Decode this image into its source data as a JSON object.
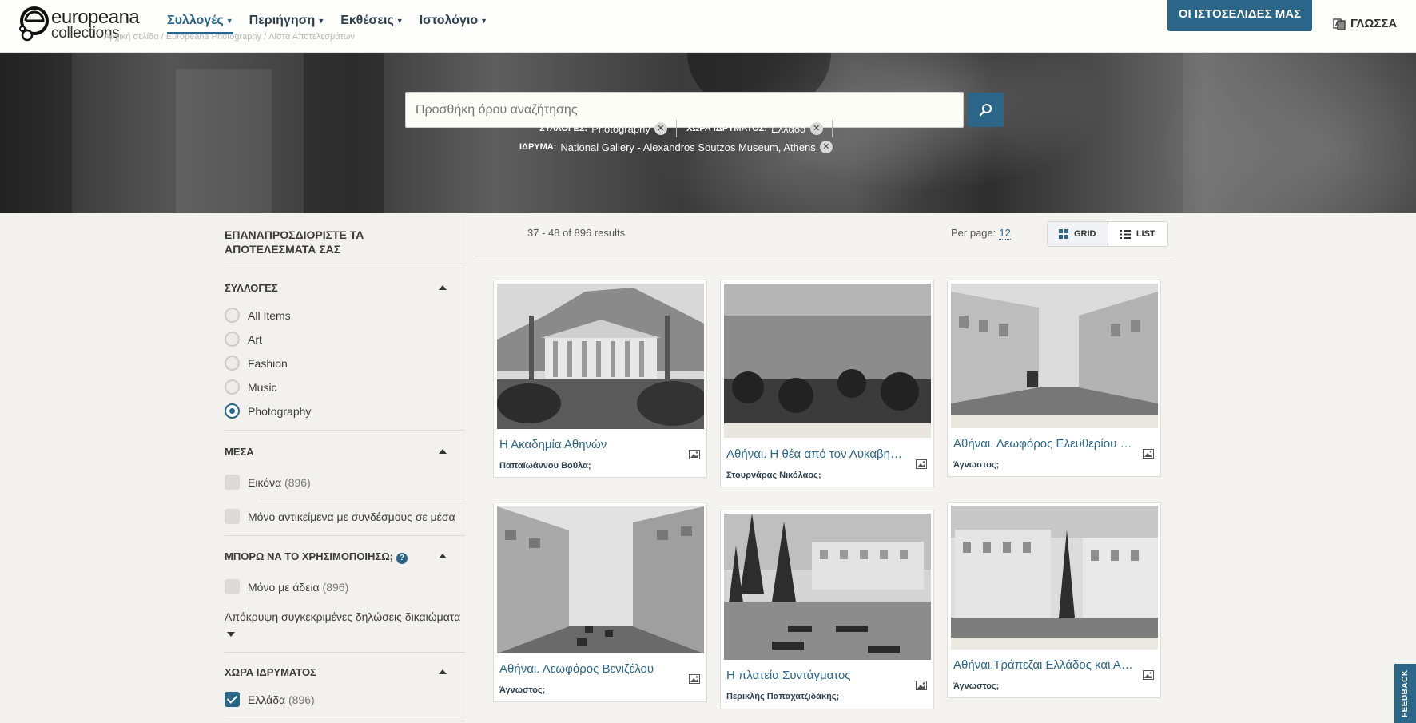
{
  "header": {
    "logo_line1": "europeana",
    "logo_line2": "collections",
    "nav": [
      {
        "label": "Συλλογές"
      },
      {
        "label": "Περιήγηση"
      },
      {
        "label": "Εκθέσεις"
      },
      {
        "label": "Ιστολόγιο"
      }
    ],
    "breadcrumbs": "Αρχική σελίδα   /   Europeana Photography   /   Λίστα Αποτελεσμάτων",
    "sites_button": "ΟΙ ΙΣΤΟΣΕΛΙΔΕΣ ΜΑΣ",
    "language": "ΓΛΩΣΣΑ"
  },
  "search": {
    "placeholder": "Προσθήκη όρου αναζήτησης",
    "filters": [
      {
        "key": "ΣΥΛΛΟΓΕΣ:",
        "value": "Photography"
      },
      {
        "key": "ΧΩΡΑ ΙΔΡΥΜΑΤΟΣ:",
        "value": "Ελλάδα"
      },
      {
        "key": "ΙΔΡΥΜΑ:",
        "value": "National Gallery - Alexandros Soutzos Museum, Athens"
      }
    ]
  },
  "sidebar": {
    "title": "ΕΠΑΝΑΠΡΟΣΔΙΟΡΙΣΤΕ ΤΑ ΑΠΟΤΕΛΕΣΜΑΤΑ ΣΑΣ",
    "collections": {
      "title": "ΣΥΛΛΟΓΕΣ",
      "options": [
        "All Items",
        "Art",
        "Fashion",
        "Music",
        "Photography"
      ],
      "selected": "Photography"
    },
    "media": {
      "title": "ΜΕΣΑ",
      "image_label": "Εικόνα",
      "image_count": "(896)",
      "links_label": "Μόνο αντικείμενα με συνδέσμους σε μέσα"
    },
    "rights": {
      "title": "ΜΠΟΡΩ ΝΑ ΤΟ ΧΡΗΣΙΜΟΠΟΙΗΣΩ;",
      "permission_label": "Μόνο με άδεια",
      "permission_count": "(896)",
      "hide_label": "Απόκρυψη συγκεκριμένες δηλώσεις δικαιώματα"
    },
    "country": {
      "title": "ΧΩΡΑ ΙΔΡΥΜΑΤΟΣ",
      "option_label": "Ελλάδα",
      "option_count": "(896)"
    }
  },
  "results": {
    "count": "37 - 48 of 896 results",
    "per_page_label": "Per page:",
    "per_page_value": "12",
    "grid_label": "GRID",
    "list_label": "LIST"
  },
  "cards": [
    {
      "title": "Η Ακαδημία Αθηνών",
      "author": "Παπαϊωάννου Βούλα;"
    },
    {
      "title": "Αθήναι. Η θέα από τον Λυκαβηττό",
      "author": "Στουρνάρας Νικόλαος;"
    },
    {
      "title": "Αθήναι. Λεωφόρος Ελευθερίου Βενιζέλου",
      "author": "Άγνωστος;"
    },
    {
      "title": "Αθήναι. Λεωφόρος Βενιζέλου",
      "author": "Άγνωστος;"
    },
    {
      "title": "Η πλατεία Συντάγματος",
      "author": "Περικλής Παπαχατζιδάκης;"
    },
    {
      "title": "Αθήναι.Τράπεζαι Ελλάδος και Αθηνών",
      "author": "Άγνωστος;"
    }
  ],
  "feedback": "FEEDBACK"
}
